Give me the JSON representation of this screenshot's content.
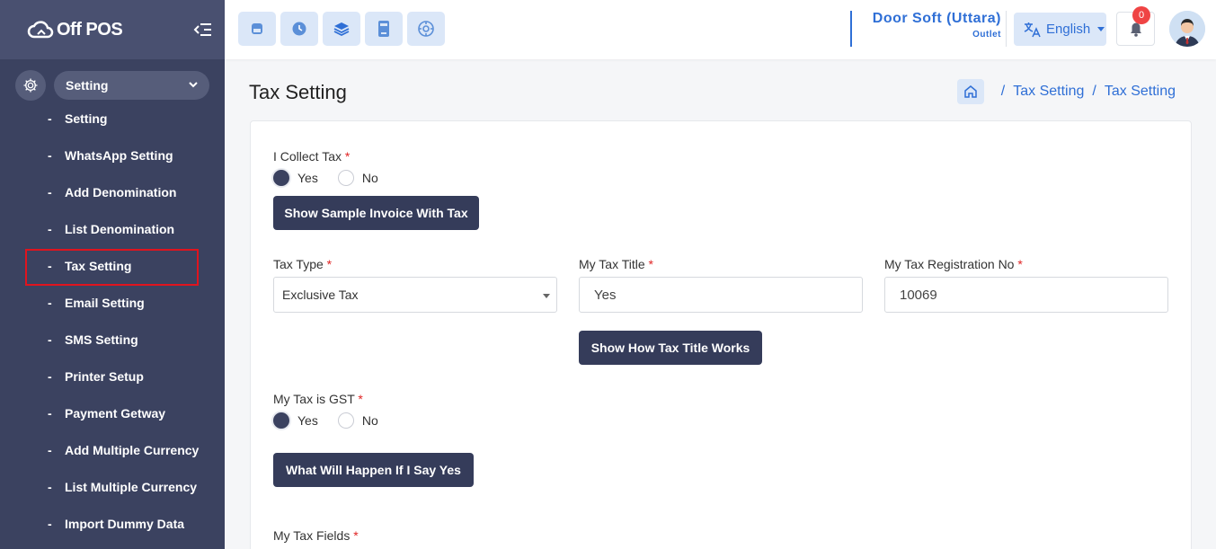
{
  "brand": {
    "name": "Off POS"
  },
  "sidebar": {
    "group_label": "Setting",
    "items": [
      {
        "label": "Setting"
      },
      {
        "label": "WhatsApp Setting"
      },
      {
        "label": "Add Denomination"
      },
      {
        "label": "List Denomination"
      },
      {
        "label": "Tax Setting",
        "active": true
      },
      {
        "label": "Email Setting"
      },
      {
        "label": "SMS Setting"
      },
      {
        "label": "Printer Setup"
      },
      {
        "label": "Payment Getway"
      },
      {
        "label": "Add Multiple Currency"
      },
      {
        "label": "List Multiple Currency"
      },
      {
        "label": "Import Dummy Data"
      }
    ]
  },
  "topbar": {
    "quick_icons": [
      "pos-register-icon",
      "clock-icon",
      "layers-icon",
      "calculator-icon",
      "dashboard-gauge-icon"
    ],
    "outlet_name": "Door Soft (Uttara)",
    "outlet_sub": "Outlet",
    "language": "English",
    "notification_count": "0"
  },
  "page": {
    "title": "Tax Setting",
    "breadcrumb": [
      "Tax Setting",
      "Tax Setting"
    ]
  },
  "form": {
    "collect_tax_label": "I Collect Tax",
    "collect_tax_yes": "Yes",
    "collect_tax_no": "No",
    "collect_tax_value": "Yes",
    "sample_invoice_button": "Show Sample Invoice With Tax",
    "tax_type_label": "Tax Type",
    "tax_type_value": "Exclusive Tax",
    "tax_title_label": "My Tax Title",
    "tax_title_value": "Yes",
    "tax_reg_label": "My Tax Registration No",
    "tax_reg_value": "10069",
    "tax_title_works_button": "Show How Tax Title Works",
    "gst_label": "My Tax is GST",
    "gst_yes": "Yes",
    "gst_no": "No",
    "gst_value": "Yes",
    "gst_explain_button": "What Will Happen If I Say Yes",
    "tax_fields_label": "My Tax Fields",
    "required_mark": "*"
  },
  "colors": {
    "sidebar": "#3b4260",
    "accent": "#2f6fd6",
    "button": "#353c5a",
    "badge": "#ef4444"
  }
}
